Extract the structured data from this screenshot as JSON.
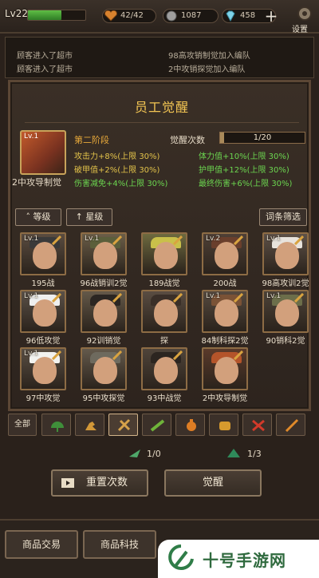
{
  "topbar": {
    "level": "Lv22",
    "xp_fraction": 0.58,
    "food": "42/42",
    "coins": "1087",
    "gems": "458",
    "settings_label": "设置"
  },
  "log": {
    "lines": [
      "顾客进入了超市",
      "顾客进入了超市",
      "98高攻销制觉加入编队",
      "2中攻销探觉加入编队"
    ]
  },
  "panel": {
    "title": "员工觉醒",
    "featured": {
      "level": "Lv.1",
      "name": "2中攻导制觉"
    },
    "stage": "第二阶段",
    "awaken_label": "觉醒次数",
    "awaken_value": "1/20",
    "awaken_fraction": 0.05,
    "stats": [
      {
        "text": "攻击力+8%(上限 30%)",
        "color": "yellow"
      },
      {
        "text": "体力值+10%(上限 30%)",
        "color": "green"
      },
      {
        "text": "破甲值+2%(上限 30%)",
        "color": "yellow"
      },
      {
        "text": "护甲值+12%(上限 30%)",
        "color": "green"
      },
      {
        "text": "伤害减免+4%(上限 30%)",
        "color": "green"
      },
      {
        "text": "最终伤害+6%(上限 30%)",
        "color": "green"
      }
    ],
    "sort_level": "等级",
    "sort_star": "星级",
    "filter": "词条筛选"
  },
  "employees": [
    {
      "lvl": "Lv.1",
      "name": "195战",
      "hat": "#3a3a3a",
      "bg": "#5a4c40"
    },
    {
      "lvl": "Lv.1",
      "name": "96战销训2觉",
      "hat": "#5b5f3b",
      "bg": "#6b5e48"
    },
    {
      "lvl": "",
      "name": "189战觉",
      "hat": "#c9c04a",
      "bg": "#6e6a3f"
    },
    {
      "lvl": "Lv.2",
      "name": "200战",
      "hat": "#6a3f2c",
      "bg": "#4f4036"
    },
    {
      "lvl": "Lv.1",
      "name": "98高攻训2觉",
      "hat": "#e8e3dc",
      "bg": "#5e5147"
    },
    {
      "lvl": "Lv.1",
      "name": "96低攻觉",
      "hat": "#efefef",
      "bg": "#5b5148"
    },
    {
      "lvl": "",
      "name": "92训销觉",
      "hat": "#2b2622",
      "bg": "#645949"
    },
    {
      "lvl": "",
      "name": "探",
      "hat": "#3a2f28",
      "bg": "#5a4d42"
    },
    {
      "lvl": "Lv.1",
      "name": "84制科探2觉",
      "hat": "#7a5236",
      "bg": "#564a3f"
    },
    {
      "lvl": "Lv.1",
      "name": "90销科2觉",
      "hat": "#6c6e4a",
      "bg": "#4d4338"
    },
    {
      "lvl": "Lv.1",
      "name": "97中攻觉",
      "hat": "#f2f2ef",
      "bg": "#5a4f44"
    },
    {
      "lvl": "",
      "name": "95中攻探觉",
      "hat": "#6e6a5e",
      "bg": "#645a4c"
    },
    {
      "lvl": "",
      "name": "93中战觉",
      "hat": "#2c2520",
      "bg": "#4f443a"
    },
    {
      "lvl": "",
      "name": "2中攻导制觉",
      "hat": "#b4542a",
      "bg": "#5a3a2a"
    }
  ],
  "tabs": {
    "all_label": "全部",
    "icons": [
      "helmet-icon",
      "arm-icon",
      "crossed-weapons-icon",
      "rifle-icon",
      "grenade-icon",
      "gloves-icon",
      "cross-swords-icon",
      "knife-icon"
    ]
  },
  "materials": [
    {
      "icon": "green-feather-icon",
      "count": "1/0"
    },
    {
      "icon": "green-gem-icon",
      "count": "1/3"
    }
  ],
  "actions": {
    "reset": "重置次数",
    "awaken": "觉醒"
  },
  "bottom_nav": [
    "商品交易",
    "商品科技"
  ],
  "watermark": "十号手游网"
}
